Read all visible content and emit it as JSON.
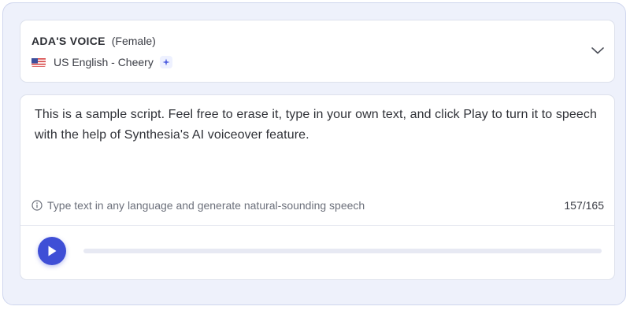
{
  "voice": {
    "name": "ADA'S VOICE",
    "gender": "(Female)",
    "language": "US English - Cheery",
    "flag_icon": "us-flag-icon",
    "sparkle_icon": "sparkle-icon",
    "dropdown_icon": "chevron-down-icon"
  },
  "script": {
    "text": "This is a sample script. Feel free to erase it, type in your own text, and click Play to turn it to speech with the help of Synthesia's AI voiceover feature.",
    "hint": "Type text in any language and generate natural-sounding speech",
    "hint_icon": "info-icon",
    "char_count": "157/165"
  },
  "player": {
    "play_icon": "play-icon",
    "progress": 0
  },
  "colors": {
    "accent": "#3f4fd6",
    "background": "#eef1fb",
    "card": "#ffffff",
    "track": "#e7e9f3"
  }
}
